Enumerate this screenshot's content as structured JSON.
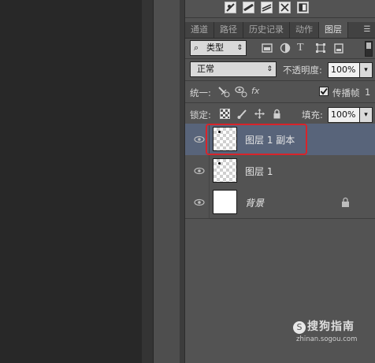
{
  "tabs": [
    {
      "label": "通道",
      "active": false
    },
    {
      "label": "路径",
      "active": false
    },
    {
      "label": "历史记录",
      "active": false
    },
    {
      "label": "动作",
      "active": false
    },
    {
      "label": "图层",
      "active": true
    }
  ],
  "filter": {
    "kind_label": "类型",
    "icons": [
      "image-filter-icon",
      "adjustment-filter-icon",
      "type-filter-icon",
      "shape-filter-icon",
      "smart-object-filter-icon"
    ],
    "type_glyph": "T"
  },
  "blend_mode": "正常",
  "opacity": {
    "label": "不透明度:",
    "value": "100%"
  },
  "unify": {
    "label": "统一:",
    "propagate_label": "传播帧",
    "propagate_value": "1",
    "propagate_checked": true
  },
  "lock": {
    "label": "锁定:"
  },
  "fill": {
    "label": "填充:",
    "value": "100%"
  },
  "layers": [
    {
      "name": "图层 1 副本",
      "selected": true,
      "visible": true,
      "thumbnail": "transparent-with-dot",
      "locked": false
    },
    {
      "name": "图层 1",
      "selected": false,
      "visible": true,
      "thumbnail": "transparent-with-dot",
      "locked": false
    },
    {
      "name": "背景",
      "selected": false,
      "visible": true,
      "thumbnail": "white",
      "locked": true
    }
  ],
  "watermark": {
    "main": "搜狗指南",
    "sub": "zhinan.sogou.com",
    "logo": "S"
  },
  "colors": {
    "panel": "#535353",
    "selection": "#58647a",
    "highlight": "#d8242a"
  }
}
